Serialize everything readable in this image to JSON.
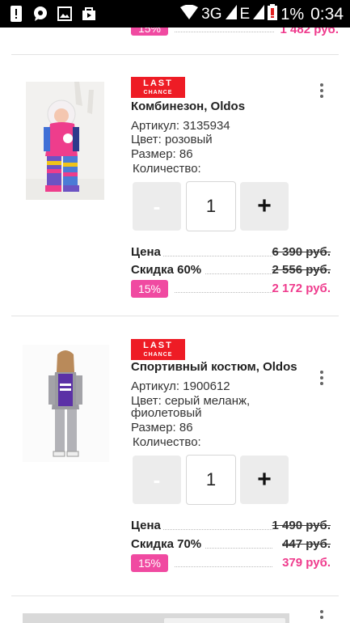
{
  "status_bar": {
    "network": "3G",
    "network2": "E",
    "battery": "1%",
    "time": "0:34"
  },
  "previous_item": {
    "discount_badge": "15%",
    "final_price": "1 482 руб."
  },
  "items": [
    {
      "badge_line1": "LAST",
      "badge_line2": "CHANCE",
      "title": "Комбинезон, Oldos",
      "article": "Артикул: 3135934",
      "color": "Цвет: розовый",
      "size": "Размер: 86",
      "quantity_label": "Количество:",
      "quantity": "1",
      "minus_label": "-",
      "plus_label": "+",
      "price_label": "Цена",
      "price": "6 390 руб.",
      "discount_label": "Скидка 60%",
      "discount_price": "2 556 руб.",
      "promo_badge": "15%",
      "final_price": "2 172 руб."
    },
    {
      "badge_line1": "LAST",
      "badge_line2": "CHANCE",
      "title": "Спортивный костюм, Oldos",
      "article": "Артикул: 1900612",
      "color": "Цвет: серый меланж,",
      "color_line2": "фиолетовый",
      "size": "Размер: 86",
      "quantity_label": "Количество:",
      "quantity": "1",
      "minus_label": "-",
      "plus_label": "+",
      "price_label": "Цена",
      "price": "1 490 руб.",
      "discount_label": "Скидка 70%",
      "discount_price": "447 руб.",
      "promo_badge": "15%",
      "final_price": "379 руб."
    }
  ]
}
